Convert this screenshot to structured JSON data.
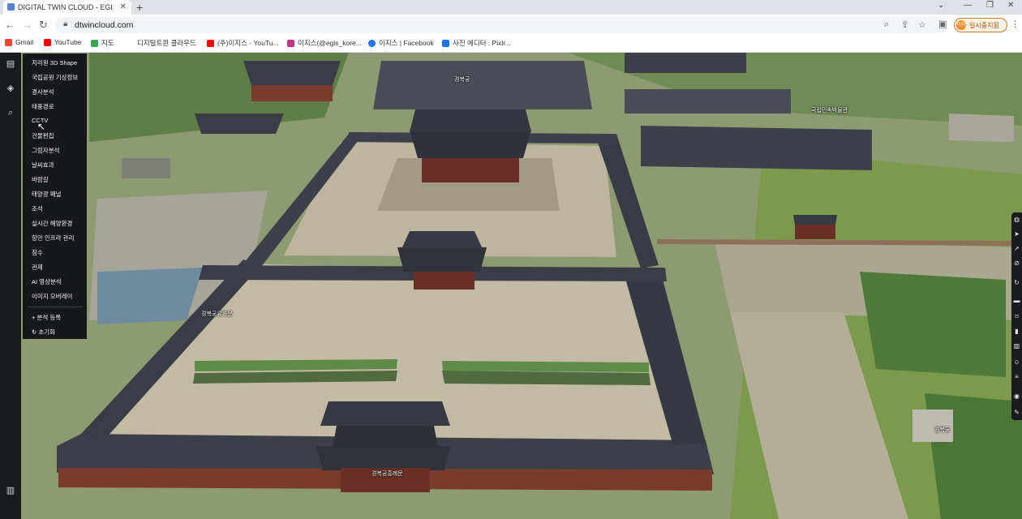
{
  "browser": {
    "tab_title": "DIGITAL TWIN CLOUD - EGISKO",
    "url": "dtwincloud.com",
    "profile_pill": "일시중지됨",
    "profile_avatar": "이지",
    "bookmarks": [
      {
        "label": "Gmail",
        "icon": "gmail-icon",
        "color": "#ea4335"
      },
      {
        "label": "YouTube",
        "icon": "youtube-icon",
        "color": "#ff0000"
      },
      {
        "label": "지도",
        "icon": "maps-icon",
        "color": "#34a853"
      },
      {
        "label": "디지털트윈 클라우드",
        "icon": "bookmark-icon",
        "color": "#ffffff"
      },
      {
        "label": "(주)이지스 - YouTu...",
        "icon": "youtube-icon",
        "color": "#ff0000"
      },
      {
        "label": "이지스(@egis_kore...",
        "icon": "instagram-icon",
        "color": "#c13584"
      },
      {
        "label": "이지스 | Facebook",
        "icon": "facebook-icon",
        "color": "#1877f2"
      },
      {
        "label": "사진 에디터 : Pixlr...",
        "icon": "pixlr-icon",
        "color": "#1a73e8"
      }
    ]
  },
  "menu": {
    "items": [
      "지리원 3D Shape",
      "국립공원 기상정보",
      "경사분석",
      "태풍경로",
      "CCTV",
      "건물편집",
      "그림자분석",
      "날씨효과",
      "바람길",
      "태양광 패널",
      "조석",
      "실시간 해양환경",
      "항만 인프라 관리",
      "침수",
      "관제",
      "AI 영상분석",
      "이미지 오버레이"
    ],
    "add_analysis": "+ 분석 등록",
    "reset": "초기화"
  },
  "map_labels": {
    "palace_top": "경복궁",
    "museum": "국립민속박물관",
    "gate_left": "경복궁유화문",
    "gate_main": "경복궁흥례문",
    "right_building": "경복궁"
  },
  "colors": {
    "menu_bg": "#17181b",
    "rail_bg": "#1a1b1e",
    "roof": "#3b3f48",
    "courtyard": "#b9b29a",
    "grass": "#7f9a5a"
  }
}
